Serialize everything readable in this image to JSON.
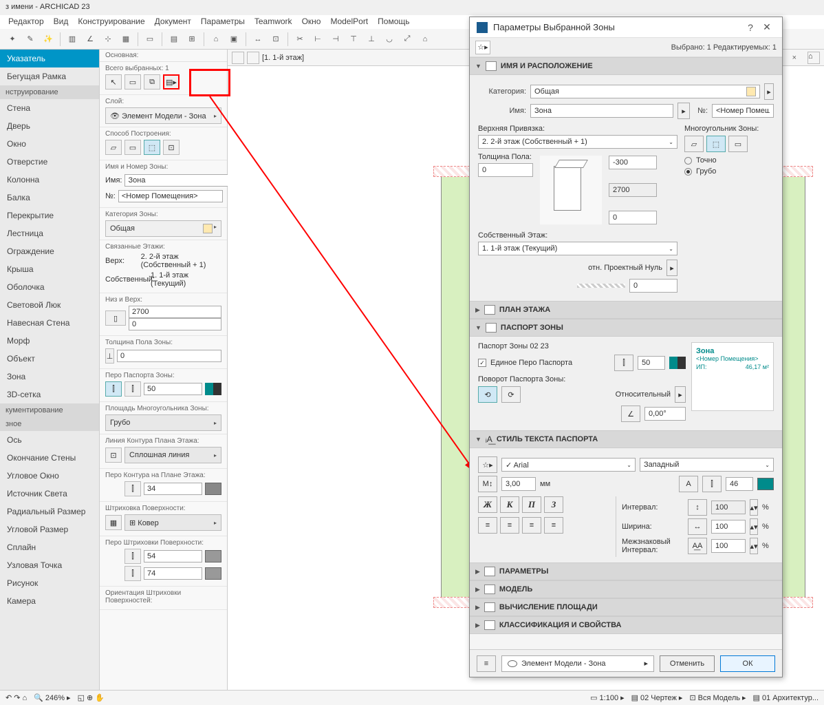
{
  "app_title": "з имени - ARCHICAD 23",
  "menu": [
    "Редактор",
    "Вид",
    "Конструирование",
    "Документ",
    "Параметры",
    "Teamwork",
    "Окно",
    "ModelPort",
    "Помощь"
  ],
  "tab": {
    "label": "[1. 1-й этаж]"
  },
  "toolbox": {
    "selected": "Указатель",
    "marquee": "Бегущая Рамка",
    "cat_design": "нструирование",
    "items_design": [
      "Стена",
      "Дверь",
      "Окно",
      "Отверстие",
      "Колонна",
      "Балка",
      "Перекрытие",
      "Лестница",
      "Ограждение",
      "Крыша",
      "Оболочка",
      "Световой Люк",
      "Навесная Стена",
      "Морф",
      "Объект",
      "Зона",
      "3D-сетка"
    ],
    "cat_doc": "кументирование",
    "cat_more": "зное",
    "items_more": [
      "Ось",
      "Окончание Стены",
      "Угловое Окно",
      "Источник Света",
      "Радиальный Размер",
      "Угловой Размер",
      "Сплайн",
      "Узловая Точка",
      "Рисунок",
      "Камера"
    ]
  },
  "infobox": {
    "hdr": "Основная:",
    "sel_count_lbl": "Всего выбранных: 1",
    "layer_lbl": "Слой:",
    "layer_val": "Элемент Модели - Зона",
    "method_lbl": "Способ Построения:",
    "name_sec": "Имя и Номер Зоны:",
    "name_lbl": "Имя:",
    "name_val": "Зона",
    "num_lbl": "№:",
    "num_val": "<Номер Помещения>",
    "cat_lbl": "Категория Зоны:",
    "cat_val": "Общая",
    "stories_lbl": "Связанные Этажи:",
    "top_lbl": "Верх:",
    "top_val": "2. 2-й этаж (Собственный + 1)",
    "own_lbl": "Собственный:",
    "own_val": "1. 1-й этаж (Текущий)",
    "hb_lbl": "Низ и Верх:",
    "h_top": "2700",
    "h_bot": "0",
    "floor_t_lbl": "Толщина Пола Зоны:",
    "floor_t": "0",
    "stamp_pen_lbl": "Перо Паспорта Зоны:",
    "stamp_pen": "50",
    "poly_area_lbl": "Площадь Многоугольника Зоны:",
    "poly_area": "Грубо",
    "outline_lbl": "Линия Контура Плана Этажа:",
    "outline_val": "Сплошная линия",
    "outline_pen_lbl": "Перо Контура на Плане Этажа:",
    "outline_pen": "34",
    "hatch_lbl": "Штриховка Поверхности:",
    "hatch_val": "Ковер",
    "hatch_pen_lbl": "Перо Штриховки Поверхности:",
    "hp1": "54",
    "hp2": "74",
    "orient_lbl": "Ориентация Штриховки Поверхностей:"
  },
  "dialog": {
    "title": "Параметры Выбранной Зоны",
    "sel_info": "Выбрано: 1 Редактируемых: 1",
    "p_name": "ИМЯ И РАСПОЛОЖЕНИЕ",
    "cat_lbl": "Категория:",
    "cat_val": "Общая",
    "name_lbl": "Имя:",
    "name_val": "Зона",
    "num_lbl": "№:",
    "num_val": "<Номер Помещ",
    "tlink_lbl": "Верхняя Привязка:",
    "tlink_val": "2. 2-й этаж (Собственный + 1)",
    "poly_lbl": "Многоугольник Зоны:",
    "poly_exact": "Точно",
    "poly_rough": "Грубо",
    "floor_lbl": "Толщина Пола:",
    "floor_val": "0",
    "off_top": "-300",
    "height": "2700",
    "off_bot": "0",
    "home_lbl": "Собственный Этаж:",
    "home_val": "1. 1-й этаж (Текущий)",
    "zero_lbl": "отн. Проектный Нуль",
    "zero_val": "0",
    "p_floor": "ПЛАН ЭТАЖА",
    "p_stamp": "ПАСПОРТ ЗОНЫ",
    "stamp_name": "Паспорт Зоны 02 23",
    "uni_pen": "Единое Перо Паспорта",
    "uni_pen_val": "50",
    "rot_lbl": "Поворот Паспорта Зоны:",
    "rot_type": "Относительный",
    "rot_val": "0,00°",
    "prev_title": "Зона",
    "prev_sub": "<Номер Помещения>",
    "prev_ip": "ИП:",
    "prev_area": "46,17 м²",
    "p_text": "СТИЛЬ ТЕКСТА ПАСПОРТА",
    "font": "Arial",
    "script": "Западный",
    "size": "3,00",
    "size_unit": "мм",
    "pen_t": "46",
    "bold": "Ж",
    "italic": "К",
    "under": "П",
    "strike": "З",
    "spacing_lbl": "Интервал:",
    "spacing": "100",
    "width_lbl": "Ширина:",
    "width": "100",
    "kern_lbl": "Межзнаковый Интервал:",
    "kern": "100",
    "pct": "%",
    "p_params": "ПАРАМЕТРЫ",
    "p_model": "МОДЕЛЬ",
    "p_calc": "ВЫЧИСЛЕНИЕ ПЛОЩАДИ",
    "p_class": "КЛАССИФИКАЦИЯ И СВОЙСТВА",
    "foot_layer": "Элемент Модели - Зона",
    "cancel": "Отменить",
    "ok": "ОК"
  },
  "status": {
    "zoom": "246%",
    "scale": "1:100",
    "view": "02 Чертеж",
    "model": "Вся Модель",
    "layers": "01 Архитектур..."
  }
}
